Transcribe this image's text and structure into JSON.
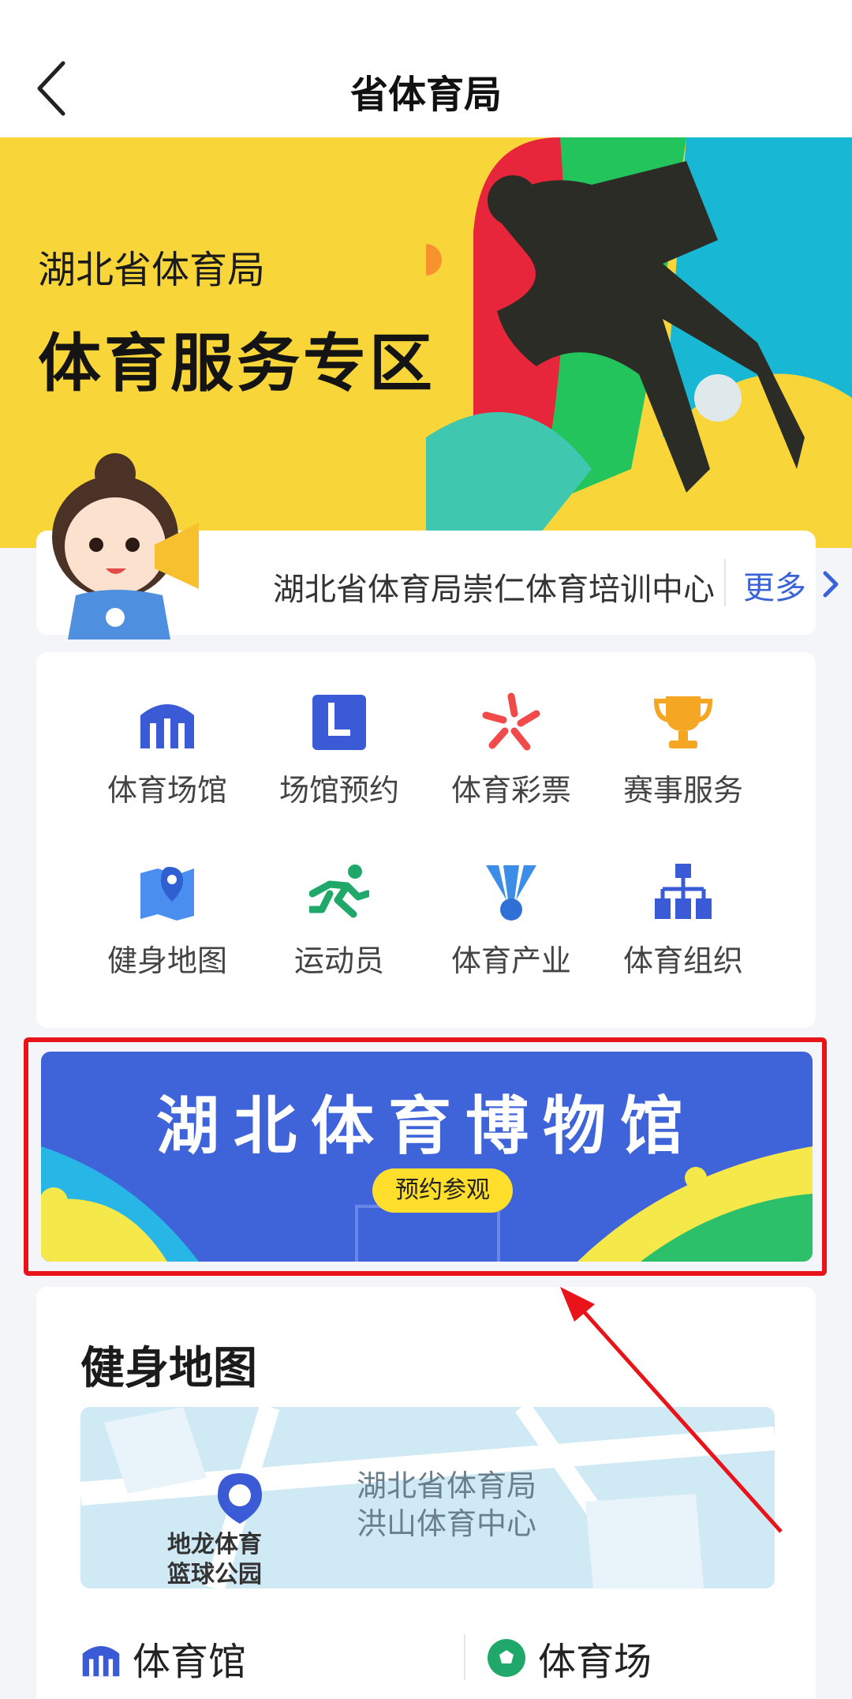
{
  "header": {
    "title": "省体育局"
  },
  "banner": {
    "subtitle": "湖北省体育局",
    "title": "体育服务专区"
  },
  "notice": {
    "text": "湖北省体育局崇仁体育培训中心",
    "more_label": "更多"
  },
  "services": [
    {
      "label": "体育场馆",
      "icon": "stadium-icon"
    },
    {
      "label": "场馆预约",
      "icon": "booking-icon"
    },
    {
      "label": "体育彩票",
      "icon": "lottery-icon"
    },
    {
      "label": "赛事服务",
      "icon": "trophy-icon"
    },
    {
      "label": "健身地图",
      "icon": "map-icon"
    },
    {
      "label": "运动员",
      "icon": "runner-icon"
    },
    {
      "label": "体育产业",
      "icon": "shuttlecock-icon"
    },
    {
      "label": "体育组织",
      "icon": "org-chart-icon"
    }
  ],
  "museum": {
    "title": "湖北体育博物馆",
    "cta": "预约参观"
  },
  "fitness_map": {
    "heading": "健身地图",
    "marker_label_line1": "地龙体育",
    "marker_label_line2": "篮球公园",
    "area_label_line1": "湖北省体育局",
    "area_label_line2": "洪山体育中心",
    "tabs": [
      {
        "label": "体育馆",
        "icon": "stadium-icon"
      },
      {
        "label": "体育场",
        "icon": "soccer-ball-icon"
      }
    ]
  },
  "colors": {
    "accent_blue": "#3b5bd6",
    "banner_yellow": "#f8d63a",
    "highlight_red": "#e8141a",
    "lottery_red": "#f04a4a",
    "trophy_orange": "#f5a623",
    "runner_green": "#1fa86a"
  }
}
